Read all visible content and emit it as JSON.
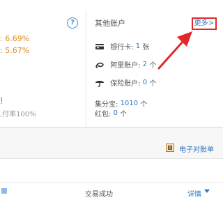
{
  "left_panel": {
    "help_icon_glyph": "?",
    "rate_1": ": 6.69%",
    "rate_2": ": 5.67%",
    "blue_mark": "!",
    "gray_text": ",付率100%"
  },
  "other_accounts": {
    "title": "其他账户",
    "more_link": "更多>",
    "items": [
      {
        "icon": "card-icon",
        "label": "银行卡:",
        "count": "1",
        "unit": "张"
      },
      {
        "icon": "alibaba-icon",
        "label": "阿里账户:",
        "count": "2",
        "unit": "个"
      },
      {
        "icon": "umbrella-icon",
        "label": "保险账户:",
        "count": "0",
        "unit": "个"
      },
      {
        "label": "集分宝:",
        "count": "1010",
        "unit": "个"
      },
      {
        "label": "红包:",
        "count": "0",
        "unit": "个"
      }
    ]
  },
  "statement": {
    "label": "电子对账单",
    "icon": "bill-icon"
  },
  "transaction": {
    "status": "交易成功",
    "details_label": "详情"
  },
  "colors": {
    "link_blue": "#2f76c2",
    "rate_orange": "#e08a1c",
    "annotation_red": "#e2282b"
  }
}
